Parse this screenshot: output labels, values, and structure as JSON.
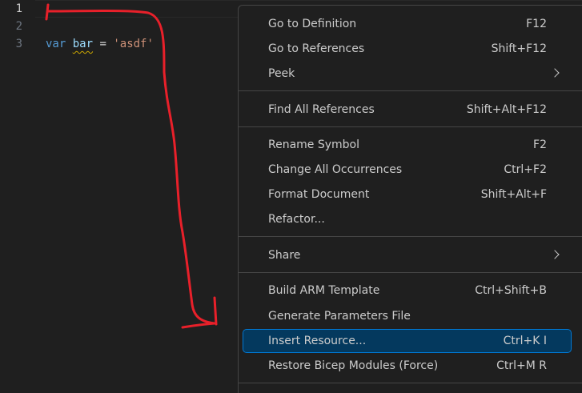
{
  "editor": {
    "line_numbers": [
      "1",
      "2",
      "3"
    ],
    "code": {
      "keyword": "var",
      "identifier": "bar",
      "operator": "=",
      "string": "'asdf'"
    }
  },
  "context_menu": {
    "items": [
      {
        "label": "Go to Definition",
        "shortcut": "F12"
      },
      {
        "label": "Go to References",
        "shortcut": "Shift+F12"
      },
      {
        "label": "Peek",
        "shortcut": ""
      },
      {
        "label": "Find All References",
        "shortcut": "Shift+Alt+F12"
      },
      {
        "label": "Rename Symbol",
        "shortcut": "F2"
      },
      {
        "label": "Change All Occurrences",
        "shortcut": "Ctrl+F2"
      },
      {
        "label": "Format Document",
        "shortcut": "Shift+Alt+F"
      },
      {
        "label": "Refactor...",
        "shortcut": ""
      },
      {
        "label": "Share",
        "shortcut": ""
      },
      {
        "label": "Build ARM Template",
        "shortcut": "Ctrl+Shift+B"
      },
      {
        "label": "Generate Parameters File",
        "shortcut": ""
      },
      {
        "label": "Insert Resource...",
        "shortcut": "Ctrl+K I"
      },
      {
        "label": "Restore Bicep Modules (Force)",
        "shortcut": "Ctrl+M R"
      }
    ],
    "selected_label": "Insert Resource..."
  },
  "colors": {
    "editor_background": "#1f1f1f",
    "menu_selection": "#04395e",
    "menu_selection_border": "#0078d4",
    "annotation_red": "#e8202a"
  }
}
